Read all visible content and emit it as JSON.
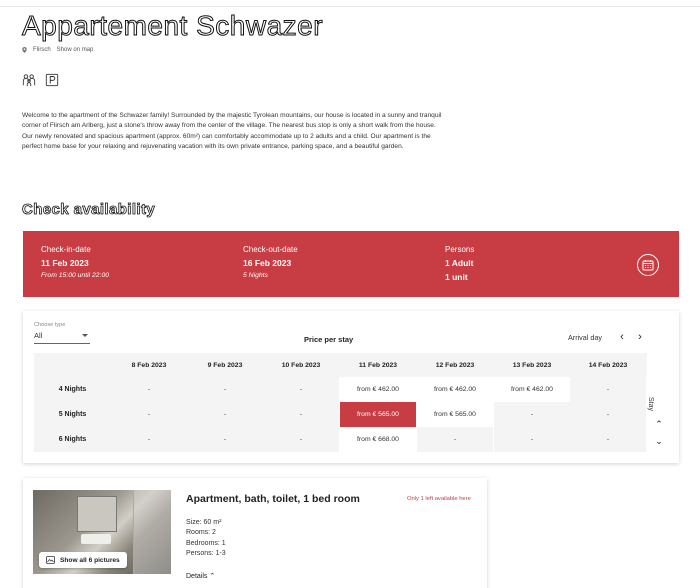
{
  "title": "Appartement Schwazer",
  "location": {
    "city": "Flirsch",
    "map_link": "Show on map"
  },
  "amenities": [
    {
      "icon": "family-icon"
    },
    {
      "icon": "parking-icon"
    }
  ],
  "description": "Welcome to the apartment of the Schwazer family! Surrounded by the majestic Tyrolean mountains, our house is located in a sunny and tranquil corner of Flirsch am Arlberg, just a stone's throw away from the center of the village. The nearest bus stop is only a short walk from the house. Our newly renovated and spacious apartment (approx. 60m²) can comfortably accommodate up to 2 adults and a child. Our apartment is the perfect home base for your relaxing and rejuvenating vacation with its own private entrance, parking space, and a beautiful garden.",
  "availability": {
    "heading": "Check availability",
    "checkin": {
      "label": "Check-in-date",
      "value": "11 Feb 2023",
      "sub": "From 15:00 until 22:00"
    },
    "checkout": {
      "label": "Check-out-date",
      "value": "16 Feb 2023",
      "sub": "5 Nights"
    },
    "persons": {
      "label": "Persons",
      "value": "1 Adult",
      "sub": "1 unit"
    },
    "accent_color": "#c73d43"
  },
  "price_table": {
    "choose_type_label": "Choose type",
    "choose_type_value": "All",
    "title": "Price per stay",
    "arrival_label": "Arrival day",
    "stay_label": "Stay",
    "dates": [
      "8 Feb 2023",
      "9 Feb 2023",
      "10 Feb 2023",
      "11 Feb 2023",
      "12 Feb 2023",
      "13 Feb 2023",
      "14 Feb 2023"
    ],
    "rows": [
      {
        "label": "4 Nights",
        "cells": [
          "-",
          "-",
          "-",
          "from € 462.00",
          "from € 462.00",
          "from € 462.00",
          "-"
        ]
      },
      {
        "label": "5 Nights",
        "cells": [
          "-",
          "-",
          "-",
          "from € 565.00",
          "from € 565.00",
          "-",
          "-"
        ]
      },
      {
        "label": "6 Nights",
        "cells": [
          "-",
          "-",
          "-",
          "from € 668.00",
          "-",
          "-",
          "-"
        ]
      }
    ]
  },
  "room": {
    "title": "Apartment, bath, toilet, 1 bed room",
    "availability_note": "Only 1 left available here",
    "show_all": "Show all 6 pictures",
    "facts": [
      "Size: 60 m²",
      "Rooms: 2",
      "Bedrooms: 1",
      "Persons: 1-3"
    ],
    "details_label": "Details"
  }
}
